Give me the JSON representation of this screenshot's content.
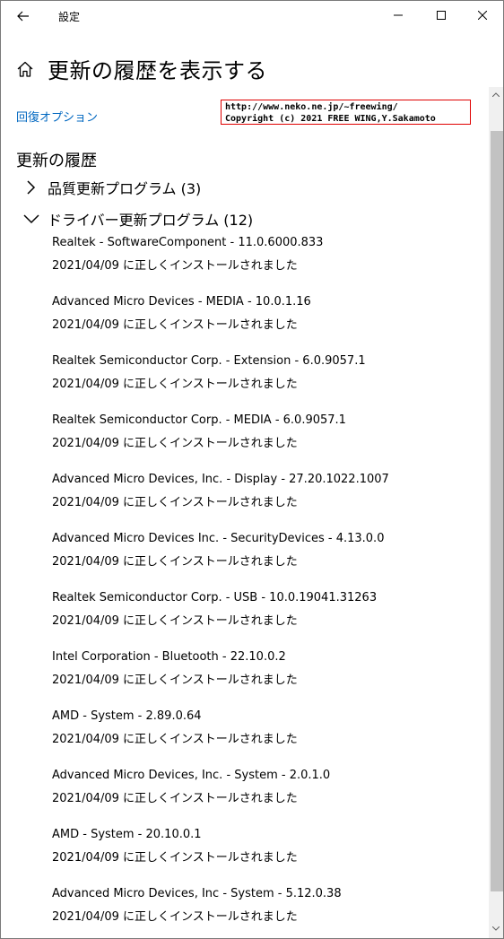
{
  "titlebar": {
    "title": "設定"
  },
  "page": {
    "title": "更新の履歴を表示する",
    "recovery_link": "回復オプション"
  },
  "watermark": {
    "line1": "http://www.neko.ne.jp/~freewing/",
    "line2": "Copyright (c) 2021 FREE WING,Y.Sakamoto"
  },
  "history": {
    "section_title": "更新の履歴",
    "groups": [
      {
        "label": "品質更新プログラム (3)",
        "expanded": false
      },
      {
        "label": "ドライバー更新プログラム (12)",
        "expanded": true
      }
    ],
    "items": [
      {
        "name": "Realtek - SoftwareComponent - 11.0.6000.833",
        "status": "2021/04/09 に正しくインストールされました"
      },
      {
        "name": "Advanced Micro Devices - MEDIA - 10.0.1.16",
        "status": "2021/04/09 に正しくインストールされました"
      },
      {
        "name": "Realtek Semiconductor Corp. - Extension - 6.0.9057.1",
        "status": "2021/04/09 に正しくインストールされました"
      },
      {
        "name": "Realtek Semiconductor Corp. - MEDIA - 6.0.9057.1",
        "status": "2021/04/09 に正しくインストールされました"
      },
      {
        "name": "Advanced Micro Devices, Inc. - Display - 27.20.1022.1007",
        "status": "2021/04/09 に正しくインストールされました"
      },
      {
        "name": "Advanced Micro Devices Inc. - SecurityDevices - 4.13.0.0",
        "status": "2021/04/09 に正しくインストールされました"
      },
      {
        "name": "Realtek Semiconductor Corp. - USB - 10.0.19041.31263",
        "status": "2021/04/09 に正しくインストールされました"
      },
      {
        "name": "Intel Corporation - Bluetooth - 22.10.0.2",
        "status": "2021/04/09 に正しくインストールされました"
      },
      {
        "name": "AMD - System - 2.89.0.64",
        "status": "2021/04/09 に正しくインストールされました"
      },
      {
        "name": "Advanced Micro Devices, Inc. - System - 2.0.1.0",
        "status": "2021/04/09 に正しくインストールされました"
      },
      {
        "name": "AMD - System - 20.10.0.1",
        "status": "2021/04/09 に正しくインストールされました"
      },
      {
        "name": "Advanced Micro Devices, Inc - System - 5.12.0.38",
        "status": "2021/04/09 に正しくインストールされました"
      }
    ]
  },
  "colors": {
    "link": "#0067c0",
    "watermark_border": "#e00000",
    "scroll_thumb": "#c2c2c2"
  },
  "icons": {
    "back": "arrow-left-icon",
    "minimize": "minimize-icon",
    "maximize": "maximize-icon",
    "close": "close-icon",
    "home": "home-icon",
    "collapsed": "chevron-right-icon",
    "expanded": "chevron-down-icon"
  }
}
